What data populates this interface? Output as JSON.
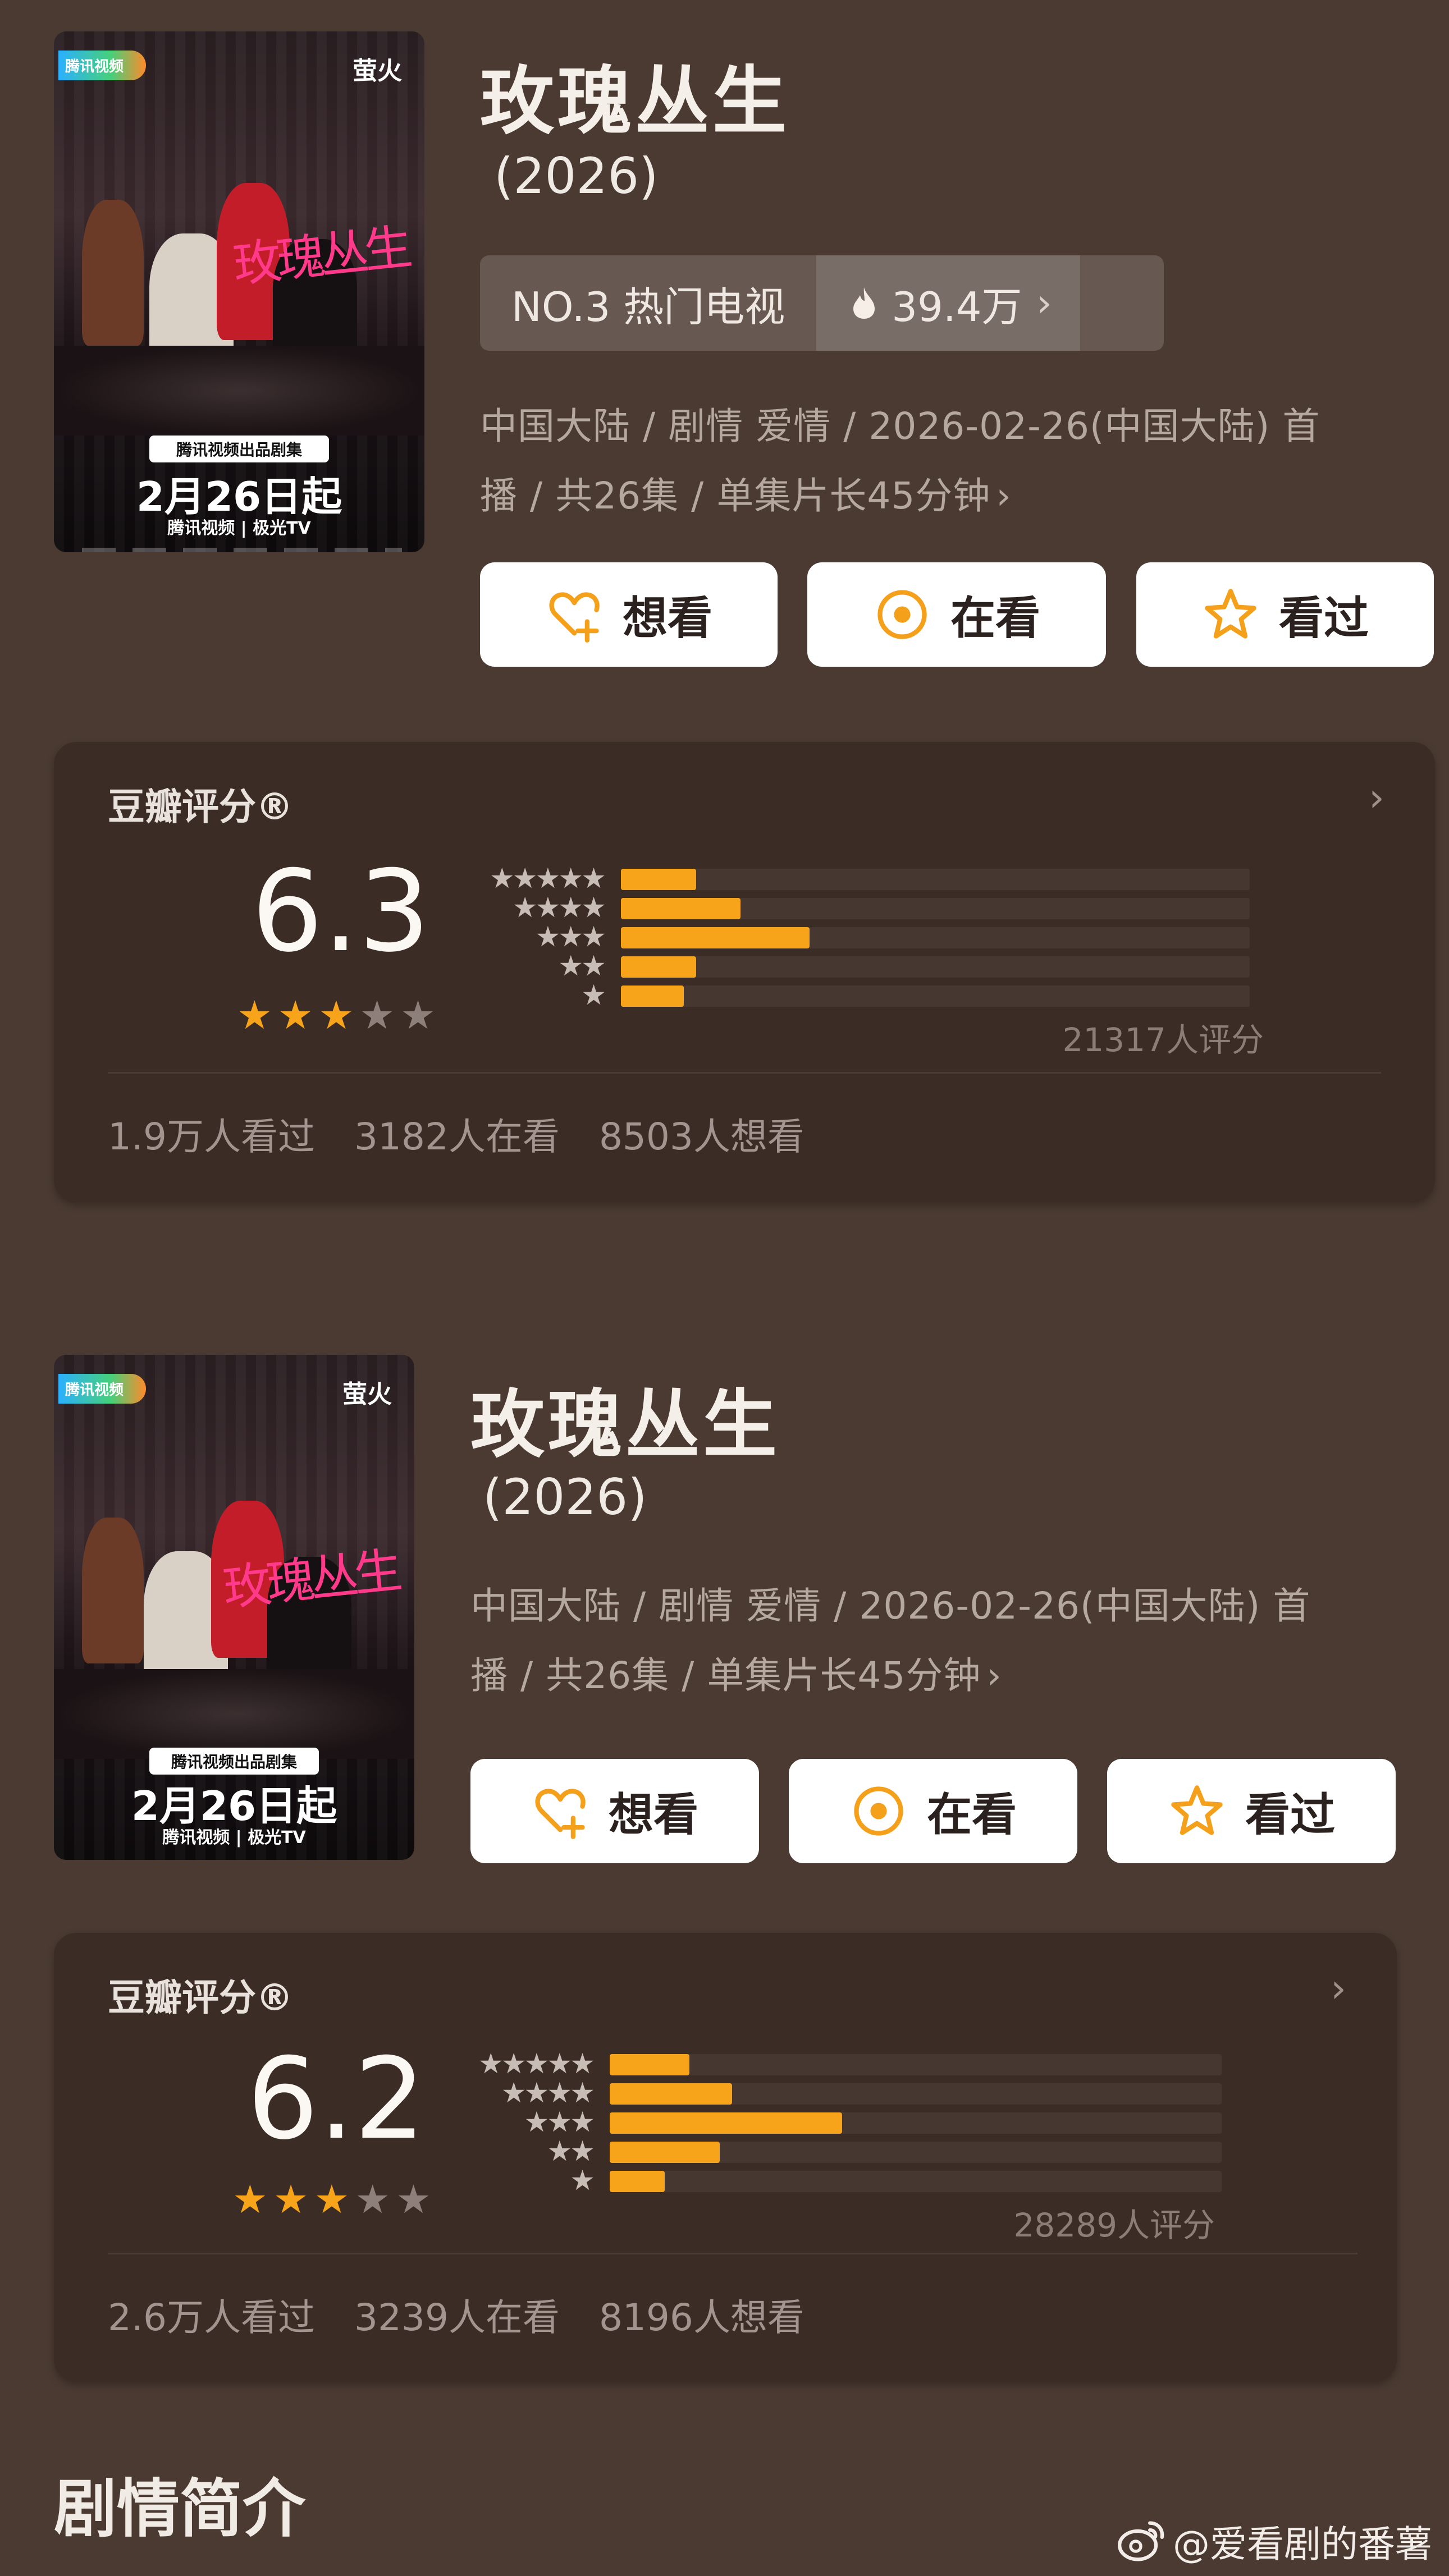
{
  "entries": [
    {
      "poster": {
        "brand": "腾讯视频",
        "studio": "萤火",
        "art_title": "玫瑰丛生",
        "badge": "腾讯视频出品剧集",
        "date": "2月26日起",
        "platforms": "腾讯视频 | 极光TV"
      },
      "title": "玫瑰丛生",
      "year": "(2026)",
      "rank": {
        "label": "NO.3 热门电视",
        "heat": "39.4万"
      },
      "meta_line1": "中国大陆 / 剧情 爱情 / 2026-02-26(中国大陆) 首",
      "meta_line2": "播 / 共26集 / 单集片长45分钟",
      "buttons": {
        "want": "想看",
        "watching": "在看",
        "watched": "看过"
      },
      "rating": {
        "label": "豆瓣评分®",
        "score": "6.3",
        "stars_filled": 3,
        "distribution": [
          0.12,
          0.19,
          0.3,
          0.12,
          0.1
        ],
        "count": "21317人评分",
        "stats": [
          "1.9万人看过",
          "3182人在看",
          "8503人想看"
        ]
      }
    },
    {
      "poster": {
        "brand": "腾讯视频",
        "studio": "萤火",
        "art_title": "玫瑰丛生",
        "badge": "腾讯视频出品剧集",
        "date": "2月26日起",
        "platforms": "腾讯视频 | 极光TV"
      },
      "title": "玫瑰丛生",
      "year": "(2026)",
      "meta_line1": "中国大陆 / 剧情 爱情 / 2026-02-26(中国大陆) 首",
      "meta_line2": "播 / 共26集 / 单集片长45分钟",
      "buttons": {
        "want": "想看",
        "watching": "在看",
        "watched": "看过"
      },
      "rating": {
        "label": "豆瓣评分®",
        "score": "6.2",
        "stars_filled": 3,
        "distribution": [
          0.13,
          0.2,
          0.38,
          0.18,
          0.09
        ],
        "count": "28289人评分",
        "stats": [
          "2.6万人看过",
          "3239人在看",
          "8196人想看"
        ]
      }
    }
  ],
  "synopsis_heading": "剧情简介",
  "watermark": "@爱看剧的番薯",
  "colors": {
    "background": "#4a3a32",
    "card": "#3b2c25",
    "accent": "#f7a41a"
  }
}
